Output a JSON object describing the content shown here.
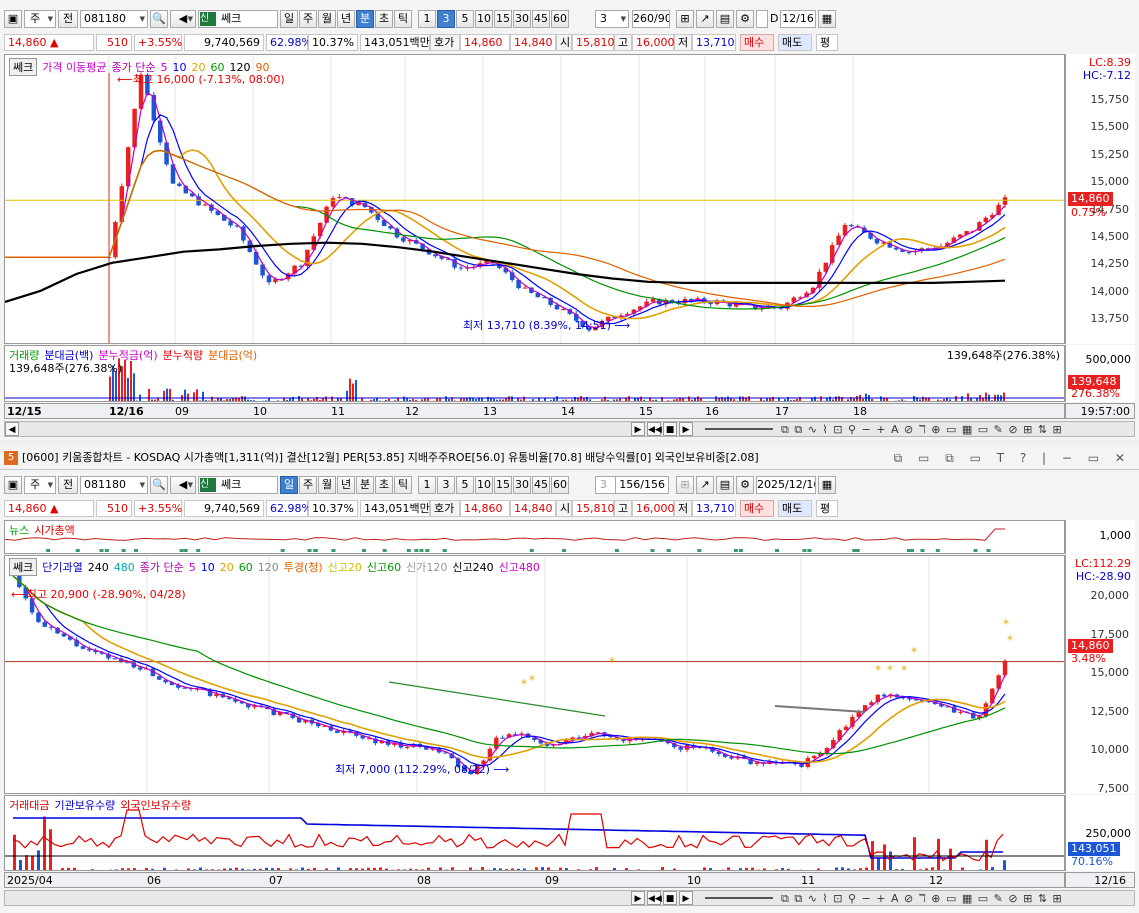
{
  "pane1": {
    "toolbar": {
      "type": "주",
      "jeon": "전",
      "code": "081180",
      "name_tag": "신",
      "name": "쎄크",
      "periods": [
        "일",
        "주",
        "월",
        "년",
        "분",
        "초",
        "틱"
      ],
      "period_selected": "분",
      "intervals": [
        "1",
        "3",
        "5",
        "10",
        "15",
        "30",
        "45",
        "60"
      ],
      "interval_selected": "3",
      "interval_value": "3",
      "count": "260/900",
      "date_chk": "D",
      "date": "12/16"
    },
    "quote": {
      "price": "14,860 ▲",
      "change": "510",
      "pct": "+3.55%",
      "volume": "9,740,569",
      "ratio1": "62.98%",
      "ratio2": "10.37%",
      "amount": "143,051백만",
      "ask_lbl": "호가",
      "ask": "14,860",
      "bid": "14,840",
      "open_lbl": "시",
      "open": "15,810",
      "high_lbl": "고",
      "high": "16,000",
      "low_lbl": "저",
      "low": "13,710",
      "buy": "매수",
      "sell": "매도",
      "eval": "평"
    },
    "legend": {
      "name": "쎄크",
      "ma_label": "가격 이동평균",
      "ma_type": "종가 단순",
      "ma": [
        "5",
        "10",
        "20",
        "60",
        "120",
        "90"
      ]
    },
    "corner": {
      "lc": "LC:8.39",
      "hc": "HC:-7.12"
    },
    "price_axis": [
      "15,750",
      "15,500",
      "15,250",
      "15,000",
      "14,750",
      "14,500",
      "14,250",
      "14,000",
      "13,750"
    ],
    "last_price": "14,860",
    "last_pct": "0.75%",
    "high_note": "최고 16,000 (-7.13%, 08:00)",
    "low_note": "최저 13,710 (8.39%, 14:51)",
    "sub_legend": [
      "거래량",
      "분대금(백)",
      "분누적금(억)",
      "분누적량",
      "분대금(억)"
    ],
    "sub_value": "139,648주(276.38%)",
    "sub_left": "139,648주(276.38%)",
    "sub_axis": "500,000",
    "sub_flag": "139,648",
    "sub_flag_pct": "276.38%",
    "dates": [
      "12/15",
      "12/16",
      "09",
      "10",
      "11",
      "12",
      "13",
      "14",
      "15",
      "16",
      "17",
      "18"
    ],
    "time_end": "19:57:00"
  },
  "pane2": {
    "title": "[0600] 키움종합차트 - KOSDAQ 시가총액[1,311(억)] 결산[12월] PER[53.85] 지배주주ROE[56.0] 유통비율[70.8] 배당수익률[0] 외국인보유비중[2.08]",
    "win_num": "5",
    "toolbar": {
      "type": "주",
      "jeon": "전",
      "code": "081180",
      "name_tag": "신",
      "name": "쎄크",
      "periods": [
        "일",
        "주",
        "월",
        "년",
        "분",
        "초",
        "틱"
      ],
      "period_selected": "일",
      "intervals": [
        "1",
        "3",
        "5",
        "10",
        "15",
        "30",
        "45",
        "60"
      ],
      "interval_value": "3",
      "count": "156/156",
      "date": "2025/12/16"
    },
    "quote": {
      "price": "14,860 ▲",
      "change": "510",
      "pct": "+3.55%",
      "volume": "9,740,569",
      "ratio1": "62.98%",
      "ratio2": "10.37%",
      "amount": "143,051백만",
      "ask_lbl": "호가",
      "ask": "14,860",
      "bid": "14,840",
      "open_lbl": "시",
      "open": "15,810",
      "high_lbl": "고",
      "high": "16,000",
      "low_lbl": "저",
      "low": "13,710",
      "buy": "매수",
      "sell": "매도",
      "eval": "평"
    },
    "news_legend": [
      "뉴스",
      "시가총액"
    ],
    "news_axis": "1,000",
    "legend": {
      "name": "쎄크",
      "items": [
        "단기과열",
        "240",
        "480",
        "종가 단순",
        "5",
        "10",
        "20",
        "60",
        "120",
        "투경(청)",
        "신고20",
        "신고60",
        "신가120",
        "신고240",
        "신고480"
      ]
    },
    "corner": {
      "lc": "LC:112.29",
      "hc": "HC:-28.90"
    },
    "price_axis": [
      "20,000",
      "17,500",
      "15,000",
      "12,500",
      "10,000",
      "7,500"
    ],
    "last_price": "14,860",
    "last_pct": "3.48%",
    "high_note": "최고 20,900 (-28.90%, 04/28)",
    "low_note": "최저 7,000 (112.29%, 08/22)",
    "sub_legend": [
      "거래대금",
      "기관보유수량",
      "외국인보유수량"
    ],
    "sub_axis": "250,000",
    "sub_flag": "143,051",
    "sub_flag_pct": "70.16%",
    "dates": [
      "2025/04",
      "06",
      "07",
      "08",
      "09",
      "10",
      "11",
      "12"
    ],
    "date_end": "12/16"
  },
  "colors": {
    "up": "#e82020",
    "down": "#1a56d6",
    "accent": "#3f7fd0"
  },
  "chart_data": [
    {
      "type": "line",
      "title": "쎄크 3분봉",
      "series": [
        {
          "name": "종가",
          "values": [
            14350,
            16000,
            15000,
            14800,
            14600,
            14100,
            14300,
            14900,
            14800,
            14550,
            14400,
            14250,
            14300,
            14050,
            13900,
            13710,
            13850,
            13950,
            13960,
            13950,
            13900,
            13900,
            14100,
            14650,
            14500,
            14400,
            14450,
            14600,
            14860
          ]
        },
        {
          "name": "120",
          "values": [
            13950,
            14050,
            14200,
            14300,
            14350,
            14400,
            14420,
            14450,
            14470,
            14480,
            14470,
            14440,
            14400,
            14350,
            14300,
            14250,
            14200,
            14160,
            14130,
            14120,
            14120,
            14120,
            14120,
            14120,
            14120,
            14120,
            14120,
            14130,
            14140
          ]
        }
      ],
      "ylim": [
        13600,
        16000
      ]
    },
    {
      "type": "line",
      "title": "쎄크 일봉",
      "series": [
        {
          "name": "종가",
          "values": [
            20900,
            17500,
            16500,
            15500,
            15000,
            14500,
            13500,
            13000,
            12500,
            12000,
            11500,
            11000,
            10500,
            10000,
            9500,
            9200,
            9000,
            8500,
            7000,
            9500,
            10000,
            9000,
            9500,
            10000,
            9500,
            9500,
            9000,
            9000,
            8500,
            8000,
            8000,
            7800,
            9000,
            11000,
            12500,
            12500,
            12000,
            11500,
            11000,
            14860
          ]
        }
      ],
      "ylim": [
        6000,
        21000
      ]
    }
  ]
}
